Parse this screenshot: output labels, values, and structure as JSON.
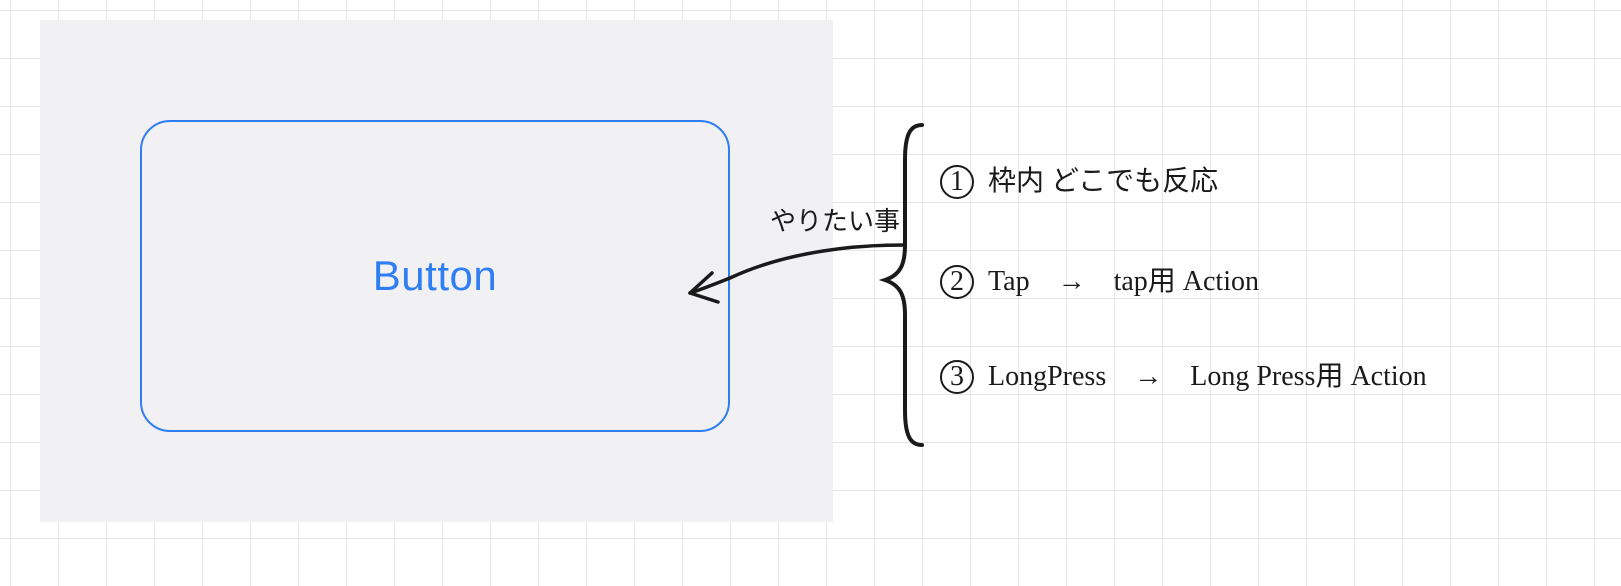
{
  "panel": {
    "button_label": "Button"
  },
  "annotation": {
    "title": "やりたい事",
    "items": [
      {
        "num": "1",
        "text": "枠内 どこでも反応"
      },
      {
        "num": "2",
        "text": "Tap　→　tap用 Action"
      },
      {
        "num": "3",
        "text": "LongPress　→　Long Press用 Action"
      }
    ]
  }
}
